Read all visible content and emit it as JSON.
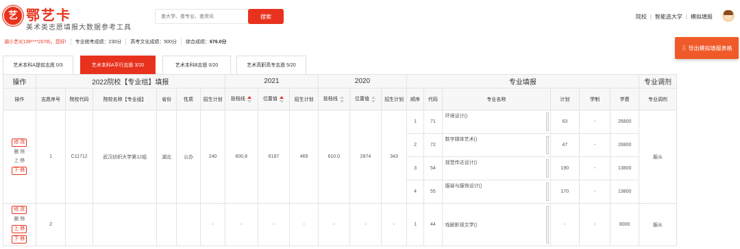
{
  "header": {
    "logo_char": "艺",
    "brand": "鄂艺卡",
    "slogan": "美术类志愿填报大数据参考工具",
    "search_placeholder": "查大学、查专业、查资讯",
    "search_button": "搜索",
    "nav": [
      "院校",
      "智能选大学",
      "模拟填报"
    ],
    "nav_sep": "|"
  },
  "info": {
    "user": "湖小艺3(139****2078)，您好!",
    "prof_score": "专业统考成绩：230分",
    "culture_score": "高考文化成绩：500分",
    "total_label": "综合成绩：",
    "total_value": "676.0分"
  },
  "export_button": "⇩ 导出模拟填报表格",
  "tabs": [
    {
      "label": "艺术本科A提前志愿 0/3",
      "active": false
    },
    {
      "label": "艺术本科A平行志愿 3/20",
      "active": true
    },
    {
      "label": "艺术本科B志愿 0/20",
      "active": false
    },
    {
      "label": "艺术高职高专志愿 5/20",
      "active": false
    }
  ],
  "table": {
    "group_headers": [
      "操作",
      "2022院校【专业组】填报",
      "2021",
      "2020",
      "专业填报",
      "专业调剂"
    ],
    "col_headers": [
      "操作",
      "志愿序号",
      "院校代码",
      "院校名称【专业组】",
      "省份",
      "性质",
      "招生计划",
      "投档线",
      "位置值",
      "招生计划",
      "投档线",
      "位置值",
      "招生计划",
      "顺序",
      "代码",
      "专业名称",
      "计划",
      "学制",
      "学费",
      "专业调剂"
    ],
    "ops": {
      "edit": "修 改",
      "delete": "删 除",
      "up": "上 移",
      "down": "下 移"
    },
    "row1": {
      "seq": "1",
      "code": "C11712",
      "name": "武汉纺织大学第12组",
      "province": "湖北",
      "type": "公办",
      "plan": "240",
      "y2021_line": "600.8",
      "y2021_pos": "6187",
      "y2021_plan": "469",
      "y2020_line": "610.0",
      "y2020_pos": "2874",
      "y2020_plan": "343",
      "adjust": "服从",
      "majors": [
        {
          "order": "1",
          "code": "71",
          "name": "环境设计()",
          "plan": "63",
          "duration": "-",
          "fee": "26800"
        },
        {
          "order": "2",
          "code": "72",
          "name": "数字媒体艺术()",
          "plan": "47",
          "duration": "-",
          "fee": "26800"
        },
        {
          "order": "3",
          "code": "54",
          "name": "视觉传达设计()",
          "plan": "190",
          "duration": "-",
          "fee": "13800"
        },
        {
          "order": "4",
          "code": "55",
          "name": "服装与服饰设计()",
          "plan": "170",
          "duration": "-",
          "fee": "13800"
        }
      ]
    },
    "row2": {
      "seq": "2",
      "plan": "-",
      "y2021_line": "-",
      "y2021_pos": "-",
      "y2021_plan": "-",
      "y2020_line": "-",
      "y2020_pos": "-",
      "y2020_plan": "-",
      "adjust": "服从",
      "major": {
        "order": "1",
        "code": "44",
        "name": "戏剧影视文学()",
        "plan": "-",
        "duration": "-",
        "fee": "8000"
      }
    }
  },
  "colors": {
    "accent": "#e8321e",
    "export": "#f05a28"
  }
}
